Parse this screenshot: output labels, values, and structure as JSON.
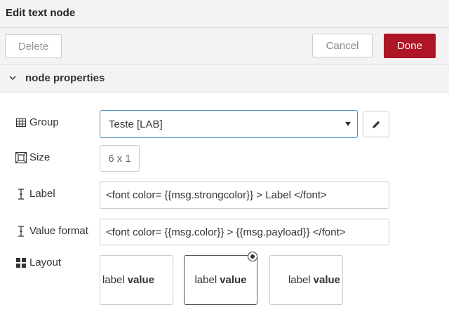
{
  "dialog": {
    "title": "Edit text node"
  },
  "toolbar": {
    "delete_label": "Delete",
    "cancel_label": "Cancel",
    "done_label": "Done"
  },
  "section": {
    "title": "node properties"
  },
  "group": {
    "label": "Group",
    "value": "Teste [LAB]"
  },
  "size": {
    "label": "Size",
    "value": "6 x 1"
  },
  "label_field": {
    "label": "Label",
    "value": "<font color= {{msg.strongcolor}} > Label </font>"
  },
  "value_format": {
    "label": "Value format",
    "value": "<font color= {{msg.color}} > {{msg.payload}} </font>"
  },
  "layout": {
    "label": "Layout",
    "selected": 1,
    "options": [
      {
        "label": "label",
        "value": "value"
      },
      {
        "label": "label",
        "value": "value"
      },
      {
        "label": "label",
        "value": "value"
      }
    ]
  },
  "colors": {
    "done_bg": "#ad1625",
    "select_border": "#4a90c2"
  },
  "icons": {
    "section_toggle": "chevron-down-icon",
    "group": "table-icon",
    "size": "resize-icon",
    "label": "text-cursor-icon",
    "value_format": "text-cursor-icon",
    "layout": "grid-icon",
    "edit": "pencil-icon"
  }
}
